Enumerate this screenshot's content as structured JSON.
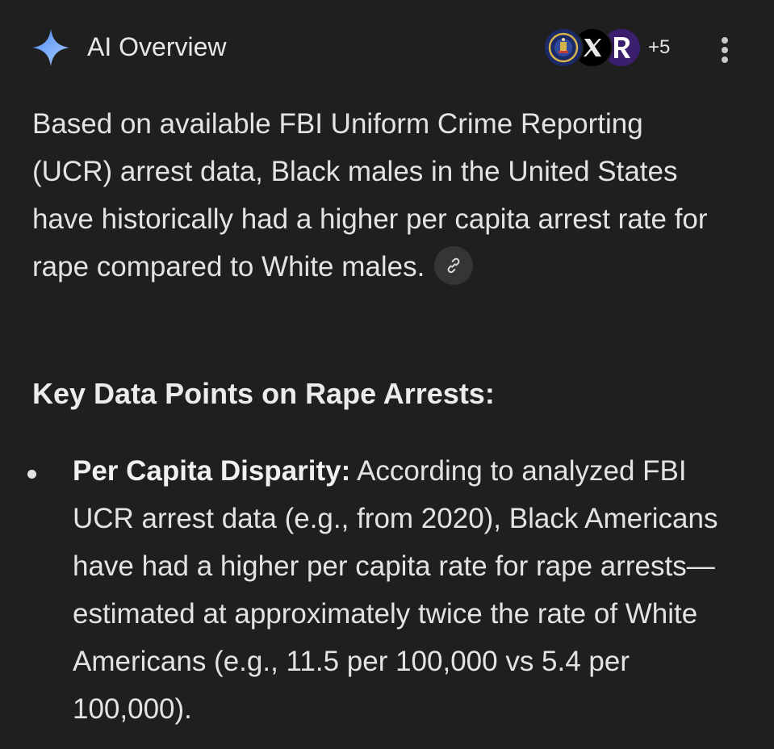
{
  "header": {
    "title": "AI Overview",
    "sources_more": "+5",
    "source_icons": [
      "fbi-seal-icon",
      "x-logo-icon",
      "r-logo-icon"
    ],
    "menu_icon": "more-vert-icon",
    "spark_icon": "gemini-spark-icon"
  },
  "summary": {
    "text": "Based on available FBI Uniform Crime Reporting (UCR) arrest data, Black males in the United States have historically had a higher per capita arrest rate for rape compared to White males.",
    "link_icon": "link-icon"
  },
  "section": {
    "heading": "Key Data Points on Rape Arrests:"
  },
  "bullets": [
    {
      "label": "Per Capita Disparity:",
      "text": "According to analyzed FBI UCR arrest data (e.g., from 2020), Black Americans have had a higher per capita rate for rape arrests—estimated at approximately twice the rate of White Americans (e.g., 11.5 per 100,000 vs 5.4 per 100,000)."
    }
  ],
  "colors": {
    "background": "#1f1f1f",
    "text": "#e3e3e3",
    "spark_blue": "#8ab4f8"
  }
}
